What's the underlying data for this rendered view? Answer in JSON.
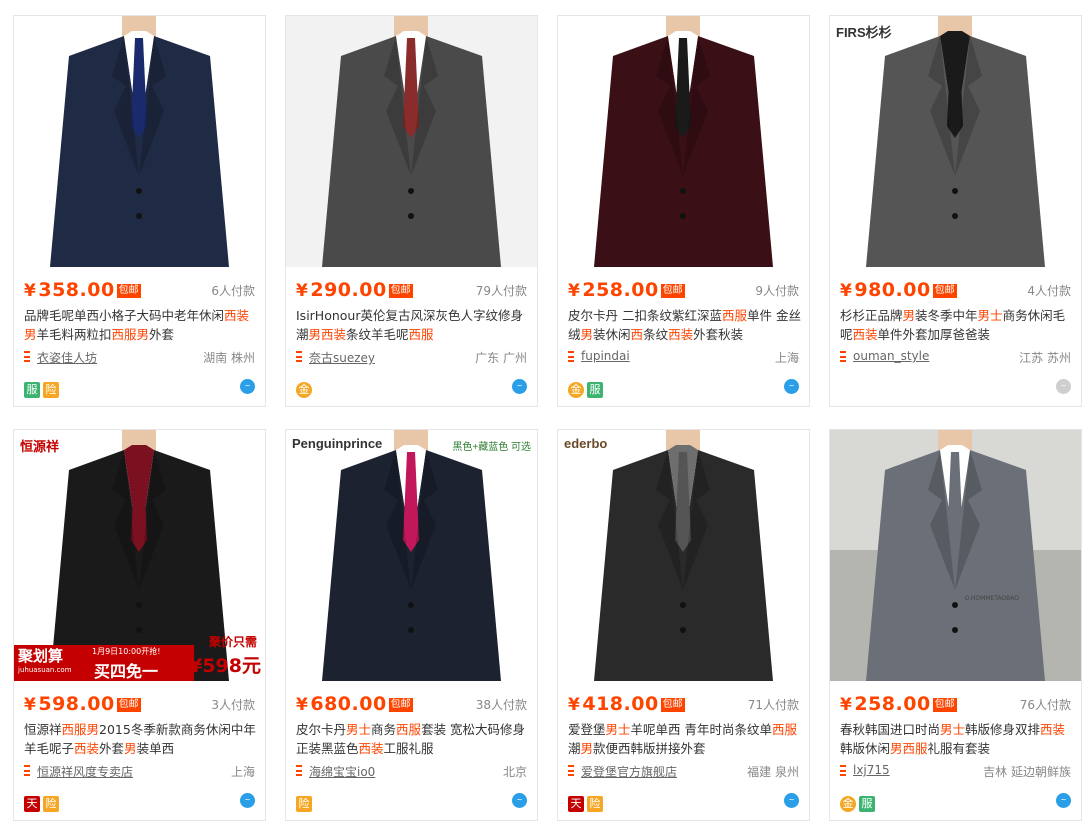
{
  "products": [
    {
      "price": "358.00",
      "paid": "6人付款",
      "title_parts": [
        [
          "品牌毛呢单西小格子大码中老年休闲",
          0
        ],
        [
          "西装男",
          1
        ],
        [
          "羊毛料两粒扣",
          0
        ],
        [
          "西服男",
          1
        ],
        [
          "外套",
          0
        ]
      ],
      "shop": "衣姿佳人坊",
      "location": "湖南 株州",
      "badges": [
        "fu",
        "xian"
      ],
      "ww": "active",
      "suit": "#1f2a44",
      "shirt": "#ffffff",
      "tie": "#1a2a6c",
      "bg": "#ffffff"
    },
    {
      "price": "290.00",
      "paid": "79人付款",
      "title_parts": [
        [
          "IsirHonour英伦复古风深灰色人字纹修身潮",
          0
        ],
        [
          "男西装",
          1
        ],
        [
          "条纹羊毛呢",
          0
        ],
        [
          "西服",
          1
        ]
      ],
      "shop": "奈古suezey",
      "location": "广东 广州",
      "badges": [
        "jin"
      ],
      "ww": "active",
      "suit": "#4a4a4a",
      "shirt": "#ffffff",
      "tie": "#8b2c2c",
      "bg": "#f2f2f2"
    },
    {
      "price": "258.00",
      "paid": "9人付款",
      "title_parts": [
        [
          "皮尔卡丹 二扣条纹紫红深蓝",
          0
        ],
        [
          "西服",
          1
        ],
        [
          "单件 金丝绒",
          0
        ],
        [
          "男",
          1
        ],
        [
          "装休闲",
          0
        ],
        [
          "西",
          1
        ],
        [
          "条纹",
          0
        ],
        [
          "西装",
          1
        ],
        [
          "外套秋装",
          0
        ]
      ],
      "shop": "fupindai",
      "location": "上海",
      "badges": [
        "jin",
        "fu"
      ],
      "ww": "active",
      "suit": "#3a0f16",
      "shirt": "#ffffff",
      "tie": "#1a1a1a",
      "bg": "#ffffff"
    },
    {
      "price": "980.00",
      "paid": "4人付款",
      "title_parts": [
        [
          "杉杉正品牌",
          0
        ],
        [
          "男",
          1
        ],
        [
          "装冬季中年",
          0
        ],
        [
          "男士",
          1
        ],
        [
          "商务休闲毛呢",
          0
        ],
        [
          "西装",
          1
        ],
        [
          "单件外套加厚爸爸装",
          0
        ]
      ],
      "shop": "ouman_style",
      "location": "江苏 苏州",
      "badges": [],
      "ww": "grey",
      "suit": "#555555",
      "shirt": "#1a1a1a",
      "tie": "#1a1a1a",
      "bg": "#ffffff",
      "brand": "FIRS杉杉"
    },
    {
      "price": "598.00",
      "paid": "3人付款",
      "title_parts": [
        [
          "恒源祥",
          0
        ],
        [
          "西服男",
          1
        ],
        [
          "2015冬季新款商务休闲中年羊毛呢子",
          0
        ],
        [
          "西装",
          1
        ],
        [
          "外套",
          0
        ],
        [
          "男",
          1
        ],
        [
          "装单西",
          0
        ]
      ],
      "shop": "恒源祥风度专卖店",
      "location": "上海",
      "badges": [
        "tm",
        "xian"
      ],
      "ww": "active",
      "suit": "#1a1a1a",
      "shirt": "#7a1020",
      "tie": "#7a1020",
      "bg": "#ffffff",
      "brand": "恒源祥",
      "promo": {
        "left1": "聚划算",
        "left2": "juhuasuan.com",
        "date": "1月9日10:00开抢!",
        "deal": "买四免一",
        "right1": "聚价只需",
        "right2": "¥598元"
      }
    },
    {
      "price": "680.00",
      "paid": "38人付款",
      "title_parts": [
        [
          "皮尔卡丹",
          0
        ],
        [
          "男士",
          1
        ],
        [
          "商务",
          0
        ],
        [
          "西服",
          1
        ],
        [
          "套装 宽松大码修身正装黑蓝色",
          0
        ],
        [
          "西装",
          1
        ],
        [
          "工服礼服",
          0
        ]
      ],
      "shop": "海绵宝宝io0",
      "location": "北京",
      "badges": [
        "xian"
      ],
      "ww": "active",
      "suit": "#1c2230",
      "shirt": "#ffffff",
      "tie": "#c2185b",
      "bg": "#ffffff",
      "brand": "Penguinprince",
      "note": "黑色+藏蓝色 可选"
    },
    {
      "price": "418.00",
      "paid": "71人付款",
      "title_parts": [
        [
          "爱登堡",
          0
        ],
        [
          "男士",
          1
        ],
        [
          "羊呢单西 青年时尚条纹单",
          0
        ],
        [
          "西服",
          1
        ],
        [
          "潮",
          0
        ],
        [
          "男",
          1
        ],
        [
          "款便西韩版拼接外套",
          0
        ]
      ],
      "shop": "爱登堡官方旗舰店",
      "location": "福建 泉州",
      "badges": [
        "tm",
        "xian"
      ],
      "ww": "active",
      "suit": "#2a2a2a",
      "shirt": "#6e6e6e",
      "tie": "#555555",
      "bg": "#ffffff",
      "brand": "ederbo"
    },
    {
      "price": "258.00",
      "paid": "76人付款",
      "title_parts": [
        [
          "春秋韩国进口时尚",
          0
        ],
        [
          "男士",
          1
        ],
        [
          "韩版修身双排",
          0
        ],
        [
          "西装",
          1
        ],
        [
          "韩版休闲",
          0
        ],
        [
          "男西服",
          1
        ],
        [
          "礼服有套装",
          0
        ]
      ],
      "shop": "lxj715",
      "location": "吉林 延边朝鲜族",
      "badges": [
        "jin",
        "fu"
      ],
      "ww": "active",
      "suit": "#6b7078",
      "shirt": "#ffffff",
      "tie": "#6b7078",
      "bg": "#c9c9c6",
      "brand": "",
      "watermark": "O.HOMMETAOBAO"
    }
  ],
  "labels": {
    "yen": "¥",
    "baoyou": "包邮",
    "fu": "服",
    "xian": "险",
    "jin": "金",
    "tm": "天"
  },
  "colors": {
    "accent": "#ff4400"
  }
}
